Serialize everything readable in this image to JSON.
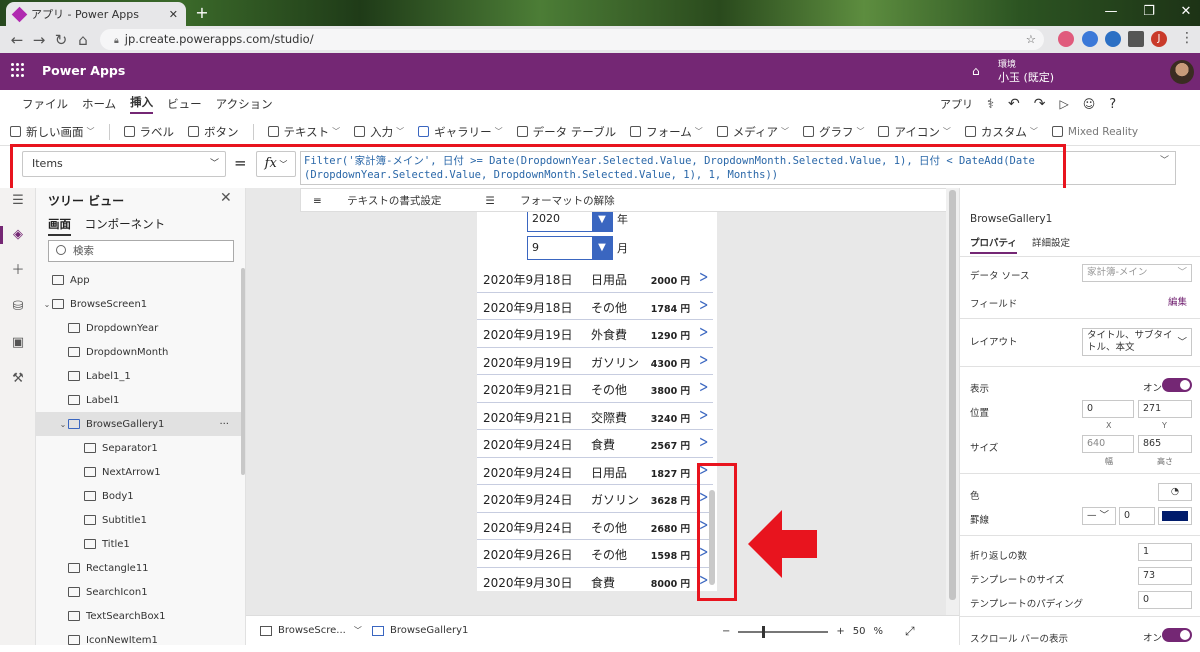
{
  "browser": {
    "tab_title": "アプリ - Power Apps",
    "url": "jp.create.powerapps.com/studio/"
  },
  "header": {
    "brand": "Power Apps",
    "env_label": "環境",
    "env_name": "小玉 (既定)"
  },
  "menu": {
    "items": [
      "ファイル",
      "ホーム",
      "挿入",
      "ビュー",
      "アクション"
    ],
    "active": "挿入",
    "app_label": "アプリ"
  },
  "ribbon": {
    "items": [
      "新しい画面",
      "ラベル",
      "ボタン",
      "テキスト",
      "入力",
      "ギャラリー",
      "データ テーブル",
      "フォーム",
      "メディア",
      "グラフ",
      "アイコン",
      "カスタム",
      "Mixed Reality"
    ]
  },
  "formula_bar": {
    "property": "Items",
    "equals": "=",
    "fx": "fx",
    "line1": "Filter('家計簿-メイン', 日付 >= Date(DropdownYear.Selected.Value, DropdownMonth.Selected.Value, 1), 日付 < DateAdd(Date",
    "line2": "(DropdownYear.Selected.Value, DropdownMonth.Selected.Value, 1), 1, Months))"
  },
  "canvas_toolbar": {
    "format_text": "テキストの書式設定",
    "clear_format": "フォーマットの解除"
  },
  "tree": {
    "title": "ツリー ビュー",
    "tabs": [
      "画面",
      "コンポーネント"
    ],
    "search_placeholder": "検索",
    "items": [
      {
        "label": "App",
        "level": 0
      },
      {
        "label": "BrowseScreen1",
        "level": 0
      },
      {
        "label": "DropdownYear",
        "level": 1
      },
      {
        "label": "DropdownMonth",
        "level": 1
      },
      {
        "label": "Label1_1",
        "level": 1
      },
      {
        "label": "Label1",
        "level": 1
      },
      {
        "label": "BrowseGallery1",
        "level": 1
      },
      {
        "label": "Separator1",
        "level": 2
      },
      {
        "label": "NextArrow1",
        "level": 2
      },
      {
        "label": "Body1",
        "level": 2
      },
      {
        "label": "Subtitle1",
        "level": 2
      },
      {
        "label": "Title1",
        "level": 2
      },
      {
        "label": "Rectangle11",
        "level": 1
      },
      {
        "label": "SearchIcon1",
        "level": 1
      },
      {
        "label": "TextSearchBox1",
        "level": 1
      },
      {
        "label": "IconNewItem1",
        "level": 1
      }
    ],
    "selected": "BrowseGallery1",
    "more": "···"
  },
  "app_screen": {
    "year": "2020",
    "year_label": "年",
    "month": "9",
    "month_label": "月",
    "rows": [
      {
        "date": "2020年9月18日",
        "cat": "日用品",
        "amt": "2000 円"
      },
      {
        "date": "2020年9月18日",
        "cat": "その他",
        "amt": "1784 円"
      },
      {
        "date": "2020年9月19日",
        "cat": "外食費",
        "amt": "1290 円"
      },
      {
        "date": "2020年9月19日",
        "cat": "ガソリン",
        "amt": "4300 円"
      },
      {
        "date": "2020年9月21日",
        "cat": "その他",
        "amt": "3800 円"
      },
      {
        "date": "2020年9月21日",
        "cat": "交際費",
        "amt": "3240 円"
      },
      {
        "date": "2020年9月24日",
        "cat": "食費",
        "amt": "2567 円"
      },
      {
        "date": "2020年9月24日",
        "cat": "日用品",
        "amt": "1827 円"
      },
      {
        "date": "2020年9月24日",
        "cat": "ガソリン",
        "amt": "3628 円"
      },
      {
        "date": "2020年9月24日",
        "cat": "その他",
        "amt": "2680 円"
      },
      {
        "date": "2020年9月26日",
        "cat": "その他",
        "amt": "1598 円"
      },
      {
        "date": "2020年9月30日",
        "cat": "食費",
        "amt": "8000 円"
      }
    ]
  },
  "bottom_bar": {
    "screen": "BrowseScre...",
    "gallery": "BrowseGallery1",
    "zoom_minus": "−",
    "zoom_plus": "+",
    "zoom_value": "50",
    "zoom_unit": "%"
  },
  "props": {
    "name": "BrowseGallery1",
    "tab_props": "プロパティ",
    "tab_adv": "詳細設定",
    "datasource_label": "データ ソース",
    "datasource_value": "家計簿-メイン",
    "fields_label": "フィールド",
    "fields_edit": "編集",
    "layout_label": "レイアウト",
    "layout_value": "タイトル、サブタイトル、本文",
    "visible_label": "表示",
    "visible_value": "オン",
    "position_label": "位置",
    "pos_x": "0",
    "pos_y": "271",
    "x_label": "X",
    "y_label": "Y",
    "size_label": "サイズ",
    "width": "640",
    "height": "865",
    "w_label": "幅",
    "h_label": "高さ",
    "color_label": "色",
    "border_label": "罫線",
    "border_width": "0",
    "border_color": "#001b6b",
    "wrap_label": "折り返しの数",
    "wrap_value": "1",
    "template_size_label": "テンプレートのサイズ",
    "template_size_value": "73",
    "template_padding_label": "テンプレートのパディング",
    "template_padding_value": "0",
    "scrollbar_label": "スクロール バーの表示",
    "scrollbar_value": "オン"
  },
  "colors": {
    "brand": "#742774",
    "highlight": "#e8141e",
    "dropdown": "#3a66c0"
  }
}
